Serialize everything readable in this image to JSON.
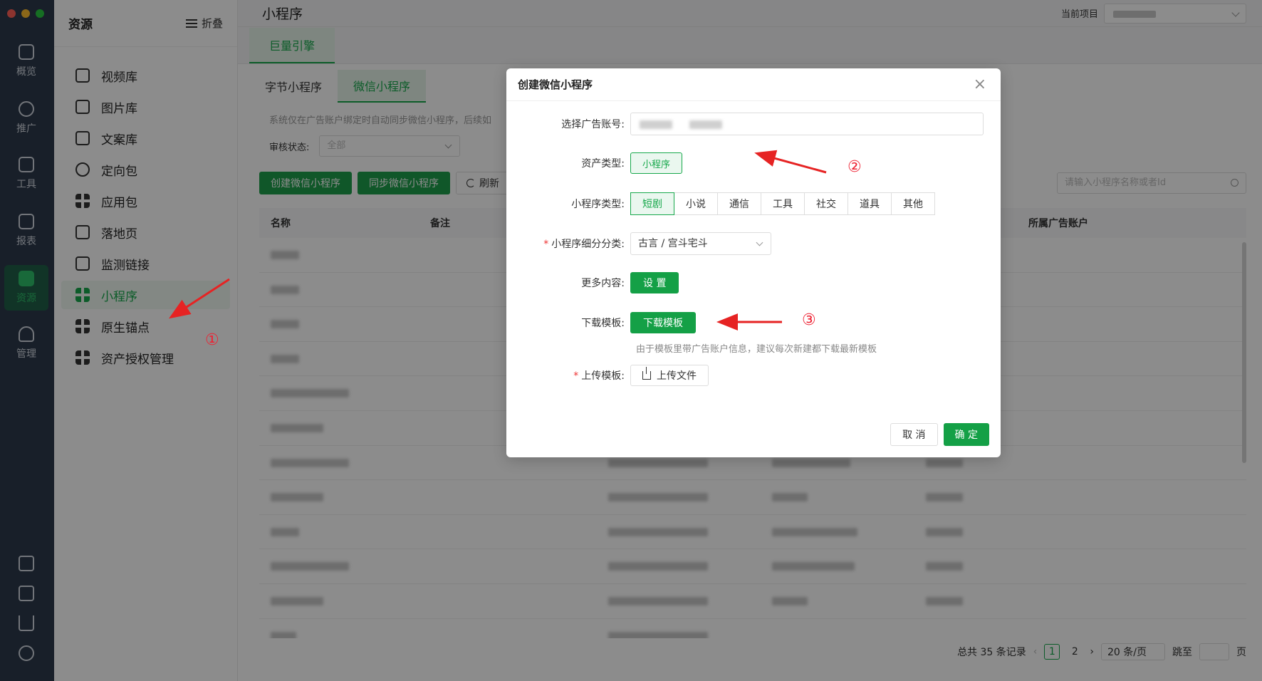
{
  "rail": {
    "items": [
      {
        "label": "概览",
        "icon": "dashboard-icon"
      },
      {
        "label": "推广",
        "icon": "promote-icon"
      },
      {
        "label": "工具",
        "icon": "tools-icon"
      },
      {
        "label": "报表",
        "icon": "report-icon"
      },
      {
        "label": "资源",
        "icon": "resource-icon",
        "active": true
      },
      {
        "label": "管理",
        "icon": "user-manage-icon"
      }
    ],
    "bottom_icons": [
      "qr-code-icon",
      "book-icon",
      "download-icon",
      "account-icon"
    ]
  },
  "sidebar": {
    "title": "资源",
    "fold_label": "折叠",
    "items": [
      {
        "label": "视频库",
        "icon": "video-icon"
      },
      {
        "label": "图片库",
        "icon": "image-icon"
      },
      {
        "label": "文案库",
        "icon": "copy-icon"
      },
      {
        "label": "定向包",
        "icon": "target-icon"
      },
      {
        "label": "应用包",
        "icon": "app-grid-icon"
      },
      {
        "label": "落地页",
        "icon": "landing-page-icon"
      },
      {
        "label": "监测链接",
        "icon": "link-icon"
      },
      {
        "label": "小程序",
        "icon": "mini-program-icon",
        "active": true
      },
      {
        "label": "原生锚点",
        "icon": "anchor-icon"
      },
      {
        "label": "资产授权管理",
        "icon": "asset-auth-icon"
      }
    ]
  },
  "header": {
    "page_title": "小程序",
    "project_label": "当前项目"
  },
  "platform_tab": "巨量引擎",
  "sub_tabs": [
    "字节小程序",
    "微信小程序"
  ],
  "notice": "系统仅在广告账户绑定时自动同步微信小程序，后续如",
  "filter": {
    "label": "审核状态:",
    "value": "全部"
  },
  "actions": {
    "create": "创建微信小程序",
    "sync": "同步微信小程序",
    "refresh": "刷新"
  },
  "search": {
    "placeholder": "请输入小程序名称或者Id"
  },
  "table": {
    "columns": [
      "名称",
      "备注",
      "所属广告账户"
    ]
  },
  "pagination": {
    "total": "总共 35 条记录",
    "pages": [
      "1",
      "2"
    ],
    "current": "1",
    "page_size": "20 条/页",
    "jump_label": "跳至",
    "page_suffix": "页"
  },
  "dialog": {
    "title": "创建微信小程序",
    "fields": {
      "account_label": "选择广告账号:",
      "asset_type_label": "资产类型:",
      "asset_type_value": "小程序",
      "mp_type_label": "小程序类型:",
      "mp_types": [
        "短剧",
        "小说",
        "通信",
        "工具",
        "社交",
        "道具",
        "其他"
      ],
      "mp_type_selected": "短剧",
      "category_label": "小程序细分分类:",
      "category_value": "古言 / 宫斗宅斗",
      "more_label": "更多内容:",
      "more_button": "设 置",
      "template_label": "下载模板:",
      "template_button": "下载模板",
      "template_hint": "由于模板里带广告账户信息，建议每次新建都下载最新模板",
      "upload_label": "上传模板:",
      "upload_button": "上传文件"
    },
    "cancel": "取 消",
    "ok": "确 定"
  },
  "annotations": [
    "①",
    "②",
    "③"
  ],
  "colors": {
    "accent": "#17a84b",
    "rail_bg": "#2d3a4b",
    "annotation": "#e62323"
  }
}
